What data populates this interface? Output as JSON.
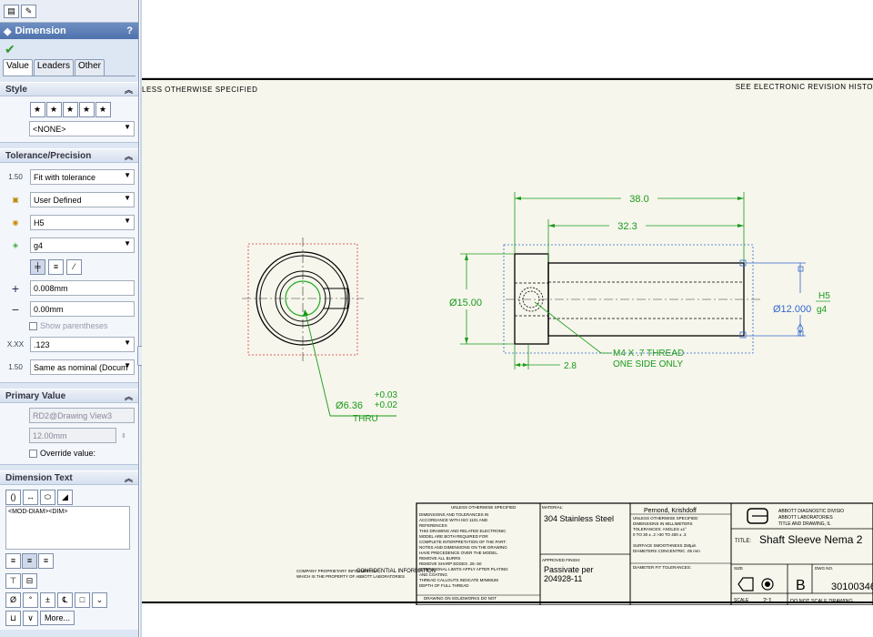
{
  "panel": {
    "title": "Dimension",
    "help": "?",
    "tabs": [
      "Value",
      "Leaders",
      "Other"
    ],
    "style": {
      "header": "Style",
      "combo": "<NONE>"
    },
    "tolerance": {
      "header": "Tolerance/Precision",
      "type": "Fit with tolerance",
      "classification": "User Defined",
      "hole_fit": "H5",
      "shaft_fit": "g4",
      "plus": "0.008mm",
      "minus": "0.00mm",
      "show_parentheses": "Show parentheses",
      "precision": ".123",
      "tol_precision": "Same as nominal (Docum",
      "icon_tol": "1.50",
      "icon_prec": "X.XX",
      "icon_tprec": "1.50"
    },
    "primary": {
      "header": "Primary Value",
      "name": "RD2@Drawing View3",
      "value": "12.00mm",
      "override": "Override value:"
    },
    "dimtext": {
      "header": "Dimension Text",
      "text": "<MOD-DIAM><DIM>",
      "more": "More..."
    }
  },
  "drawing": {
    "corner_left": "LESS OTHERWISE SPECIFIED",
    "corner_right": "SEE ELECTRONIC REVISION HISTO",
    "dims": {
      "length_overall": "38.0",
      "length_inner": "32.3",
      "diameter_outer": "Ø15.00",
      "diameter_shaft": "Ø12.000",
      "fit_hole": "H5",
      "fit_shaft": "g4",
      "thread_note_1": "M4 X .7 THREAD",
      "thread_note_2": "ONE SIDE ONLY",
      "step": "2.8",
      "bore": "Ø6.36",
      "bore_tol_plus": "+0.03",
      "bore_tol_minus": "+0.02",
      "bore_thru": "THRU"
    },
    "title_block": {
      "conf": "CONFIDENTIAL INFORMATION",
      "material_label": "MATERIAL:",
      "material": "304 Stainless Steel",
      "finish_label": "APPROVED FINISH:",
      "finish_1": "Passivate per",
      "finish_2": "204928-11",
      "drawn_by": "Pernond, Krishdoff",
      "company_1": "ABBOTT DIAGNOSTIC DIVISIO",
      "company_2": "ABBOTT LABORATORIES",
      "company_3": "TITLE AND DRAWING, IL",
      "title_label": "TITLE:",
      "title": "Shaft Sleeve Nema 2",
      "size": "B",
      "dwg_no": "30100346-",
      "scale_label": "SCALE",
      "scale": "2:1",
      "no_scale": "DO NOT SCALE DRAWING",
      "size_label": "SIZE",
      "dwgno_label": "DWG NO."
    }
  }
}
